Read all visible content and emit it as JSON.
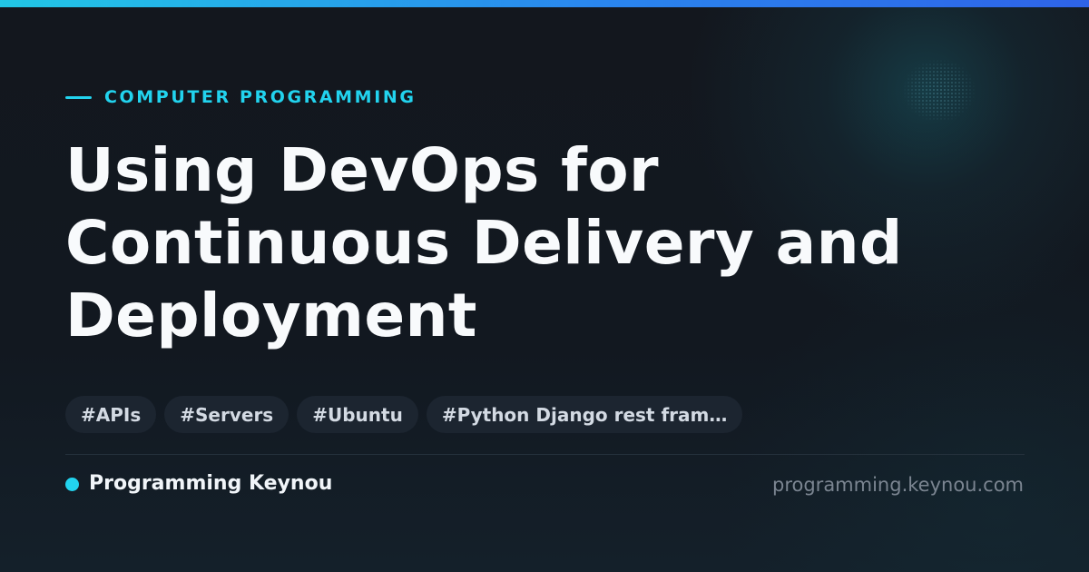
{
  "category": {
    "label": "COMPUTER PROGRAMMING"
  },
  "article": {
    "title": "Using DevOps for Continuous Delivery and Deployment"
  },
  "tags": [
    "#APIs",
    "#Servers",
    "#Ubuntu",
    "#Python Django rest fram…"
  ],
  "footer": {
    "author": "Programming Keynou",
    "site": "programming.keynou.com"
  },
  "colors": {
    "accent": "#22d3ee",
    "background": "#121820",
    "top_bar_start": "#22c7e6",
    "top_bar_end": "#2e63e8",
    "tag_background": "#1c2530",
    "title_text": "#f8fafc",
    "muted_text": "#7b8591"
  }
}
